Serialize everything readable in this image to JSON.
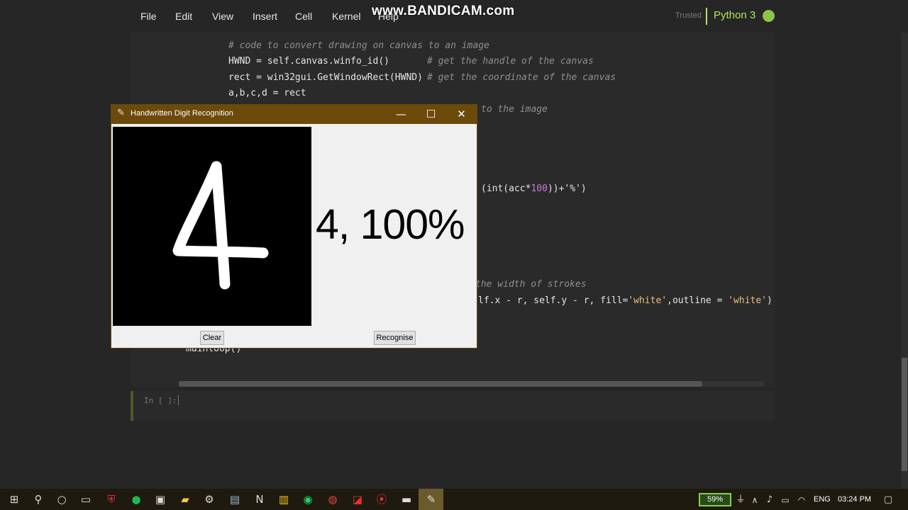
{
  "menubar": {
    "items": [
      "File",
      "Edit",
      "View",
      "Insert",
      "Cell",
      "Kernel",
      "Help"
    ],
    "watermark": "www.BANDICAM.com",
    "trusted": "Trusted",
    "kernel": "Python 3"
  },
  "code": {
    "line1_comment": "# code to convert drawing on canvas to an image",
    "line2_code": "HWND = self.canvas.winfo_id()",
    "line2_comment": "# get the handle of the canvas",
    "line3_code": "rect = win32gui.GetWindowRect(HWND)",
    "line3_comment": "# get the coordinate of the canvas",
    "line4_code": "a,b,c,d = rect",
    "line5_comment": "to the image",
    "line6_pre": "(int(acc*",
    "line6_num": "100",
    "line6_post": "))+'%')",
    "line7_comment": "the width of strokes",
    "line8_pre": "lf.x - r, self.y - r, fill=",
    "line8_str1": "'white'",
    "line8_mid": ",outline = ",
    "line8_str2": "'white'",
    "line8_post": ")",
    "line9_code": "mainloop()"
  },
  "input_cell": {
    "prompt": "In [ ]:"
  },
  "tk_window": {
    "title": "Handwritten Digit Recognition",
    "minimize": "—",
    "maximize": "☐",
    "close": "✕",
    "result": "4, 100%",
    "clear_label": "Clear",
    "recognise_label": "Recognise"
  },
  "taskbar": {
    "battery": "59%",
    "language": "ENG",
    "clock": "03:24 PM"
  },
  "colors": {
    "accent": "#b6e35a",
    "tk_titlebar": "#6b4a0a",
    "taskbar": "#1f1a10"
  }
}
